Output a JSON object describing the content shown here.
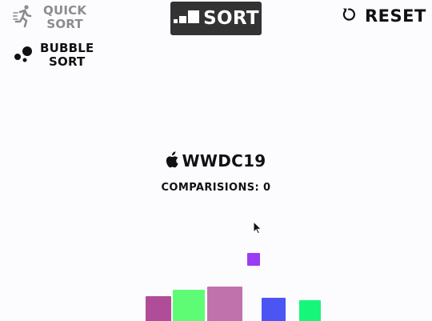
{
  "menu": {
    "quick_sort": {
      "line1": "QUICK",
      "line2": "SORT",
      "icon": "running-person-icon"
    },
    "bubble_sort": {
      "line1": "BUBBLE",
      "line2": "SORT",
      "icon": "bubbles-icon"
    }
  },
  "toolbar": {
    "sort_label": "SORT",
    "sort_icon": "ascending-bars-icon",
    "reset_label": "RESET",
    "reset_icon": "reset-arrow-icon"
  },
  "title": {
    "apple_icon": "apple-logo-icon",
    "text": "WWDC19"
  },
  "comparisons": {
    "label": "COMPARISIONS: 0",
    "count": 0
  },
  "bars": [
    {
      "color": "#b04d98",
      "size": 32
    },
    {
      "color": "#5efc74",
      "size": 40
    },
    {
      "color": "#c072ac",
      "size": 44
    },
    {
      "color": "#9a3cf4",
      "size": 16
    },
    {
      "color": "#4a55f3",
      "size": 30
    },
    {
      "color": "#16f77a",
      "size": 27
    }
  ]
}
